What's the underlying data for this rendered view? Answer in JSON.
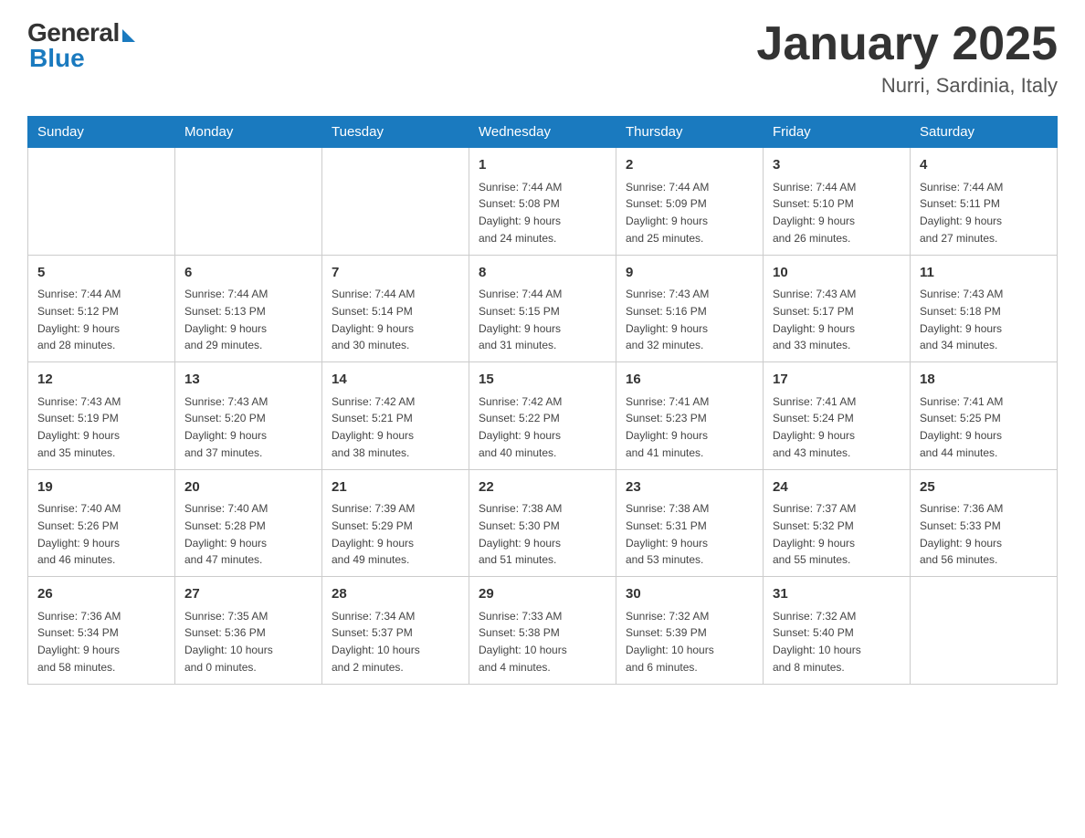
{
  "header": {
    "logo": {
      "general": "General",
      "blue": "Blue"
    },
    "title": "January 2025",
    "subtitle": "Nurri, Sardinia, Italy"
  },
  "days_of_week": [
    "Sunday",
    "Monday",
    "Tuesday",
    "Wednesday",
    "Thursday",
    "Friday",
    "Saturday"
  ],
  "weeks": [
    [
      {
        "day": "",
        "info": ""
      },
      {
        "day": "",
        "info": ""
      },
      {
        "day": "",
        "info": ""
      },
      {
        "day": "1",
        "info": "Sunrise: 7:44 AM\nSunset: 5:08 PM\nDaylight: 9 hours\nand 24 minutes."
      },
      {
        "day": "2",
        "info": "Sunrise: 7:44 AM\nSunset: 5:09 PM\nDaylight: 9 hours\nand 25 minutes."
      },
      {
        "day": "3",
        "info": "Sunrise: 7:44 AM\nSunset: 5:10 PM\nDaylight: 9 hours\nand 26 minutes."
      },
      {
        "day": "4",
        "info": "Sunrise: 7:44 AM\nSunset: 5:11 PM\nDaylight: 9 hours\nand 27 minutes."
      }
    ],
    [
      {
        "day": "5",
        "info": "Sunrise: 7:44 AM\nSunset: 5:12 PM\nDaylight: 9 hours\nand 28 minutes."
      },
      {
        "day": "6",
        "info": "Sunrise: 7:44 AM\nSunset: 5:13 PM\nDaylight: 9 hours\nand 29 minutes."
      },
      {
        "day": "7",
        "info": "Sunrise: 7:44 AM\nSunset: 5:14 PM\nDaylight: 9 hours\nand 30 minutes."
      },
      {
        "day": "8",
        "info": "Sunrise: 7:44 AM\nSunset: 5:15 PM\nDaylight: 9 hours\nand 31 minutes."
      },
      {
        "day": "9",
        "info": "Sunrise: 7:43 AM\nSunset: 5:16 PM\nDaylight: 9 hours\nand 32 minutes."
      },
      {
        "day": "10",
        "info": "Sunrise: 7:43 AM\nSunset: 5:17 PM\nDaylight: 9 hours\nand 33 minutes."
      },
      {
        "day": "11",
        "info": "Sunrise: 7:43 AM\nSunset: 5:18 PM\nDaylight: 9 hours\nand 34 minutes."
      }
    ],
    [
      {
        "day": "12",
        "info": "Sunrise: 7:43 AM\nSunset: 5:19 PM\nDaylight: 9 hours\nand 35 minutes."
      },
      {
        "day": "13",
        "info": "Sunrise: 7:43 AM\nSunset: 5:20 PM\nDaylight: 9 hours\nand 37 minutes."
      },
      {
        "day": "14",
        "info": "Sunrise: 7:42 AM\nSunset: 5:21 PM\nDaylight: 9 hours\nand 38 minutes."
      },
      {
        "day": "15",
        "info": "Sunrise: 7:42 AM\nSunset: 5:22 PM\nDaylight: 9 hours\nand 40 minutes."
      },
      {
        "day": "16",
        "info": "Sunrise: 7:41 AM\nSunset: 5:23 PM\nDaylight: 9 hours\nand 41 minutes."
      },
      {
        "day": "17",
        "info": "Sunrise: 7:41 AM\nSunset: 5:24 PM\nDaylight: 9 hours\nand 43 minutes."
      },
      {
        "day": "18",
        "info": "Sunrise: 7:41 AM\nSunset: 5:25 PM\nDaylight: 9 hours\nand 44 minutes."
      }
    ],
    [
      {
        "day": "19",
        "info": "Sunrise: 7:40 AM\nSunset: 5:26 PM\nDaylight: 9 hours\nand 46 minutes."
      },
      {
        "day": "20",
        "info": "Sunrise: 7:40 AM\nSunset: 5:28 PM\nDaylight: 9 hours\nand 47 minutes."
      },
      {
        "day": "21",
        "info": "Sunrise: 7:39 AM\nSunset: 5:29 PM\nDaylight: 9 hours\nand 49 minutes."
      },
      {
        "day": "22",
        "info": "Sunrise: 7:38 AM\nSunset: 5:30 PM\nDaylight: 9 hours\nand 51 minutes."
      },
      {
        "day": "23",
        "info": "Sunrise: 7:38 AM\nSunset: 5:31 PM\nDaylight: 9 hours\nand 53 minutes."
      },
      {
        "day": "24",
        "info": "Sunrise: 7:37 AM\nSunset: 5:32 PM\nDaylight: 9 hours\nand 55 minutes."
      },
      {
        "day": "25",
        "info": "Sunrise: 7:36 AM\nSunset: 5:33 PM\nDaylight: 9 hours\nand 56 minutes."
      }
    ],
    [
      {
        "day": "26",
        "info": "Sunrise: 7:36 AM\nSunset: 5:34 PM\nDaylight: 9 hours\nand 58 minutes."
      },
      {
        "day": "27",
        "info": "Sunrise: 7:35 AM\nSunset: 5:36 PM\nDaylight: 10 hours\nand 0 minutes."
      },
      {
        "day": "28",
        "info": "Sunrise: 7:34 AM\nSunset: 5:37 PM\nDaylight: 10 hours\nand 2 minutes."
      },
      {
        "day": "29",
        "info": "Sunrise: 7:33 AM\nSunset: 5:38 PM\nDaylight: 10 hours\nand 4 minutes."
      },
      {
        "day": "30",
        "info": "Sunrise: 7:32 AM\nSunset: 5:39 PM\nDaylight: 10 hours\nand 6 minutes."
      },
      {
        "day": "31",
        "info": "Sunrise: 7:32 AM\nSunset: 5:40 PM\nDaylight: 10 hours\nand 8 minutes."
      },
      {
        "day": "",
        "info": ""
      }
    ]
  ]
}
